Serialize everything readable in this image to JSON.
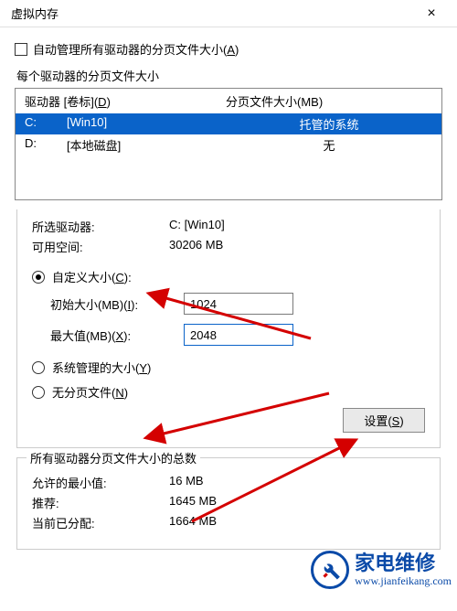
{
  "window": {
    "title": "虚拟内存",
    "close": "×"
  },
  "auto_manage": {
    "label_pre": "自动管理所有驱动器的分页文件大小(",
    "hotkey": "A",
    "label_post": ")"
  },
  "drive_section_label": "每个驱动器的分页文件大小",
  "drive_header": {
    "drive_pre": "驱动器 [卷标](",
    "drive_hotkey": "D",
    "drive_post": ")",
    "size": "分页文件大小(MB)"
  },
  "drives": [
    {
      "letter": "C:",
      "label": "[Win10]",
      "size": "托管的系统",
      "selected": true
    },
    {
      "letter": "D:",
      "label": "[本地磁盘]",
      "size": "无",
      "selected": false
    }
  ],
  "selected_info": {
    "drive_label": "所选驱动器:",
    "drive_value": "C:  [Win10]",
    "free_label": "可用空间:",
    "free_value": "30206 MB"
  },
  "custom": {
    "label_pre": "自定义大小(",
    "hotkey": "C",
    "label_post": "):",
    "initial_label_pre": "初始大小(MB)(",
    "initial_hotkey": "I",
    "initial_label_post": "):",
    "initial_value": "1024",
    "max_label_pre": "最大值(MB)(",
    "max_hotkey": "X",
    "max_label_post": "):",
    "max_value": "2048"
  },
  "system_managed": {
    "label_pre": "系统管理的大小(",
    "hotkey": "Y",
    "label_post": ")"
  },
  "no_paging": {
    "label_pre": "无分页文件(",
    "hotkey": "N",
    "label_post": ")"
  },
  "set_button": {
    "label_pre": "设置(",
    "hotkey": "S",
    "label_post": ")"
  },
  "totals": {
    "title": "所有驱动器分页文件大小的总数",
    "min_label": "允许的最小值:",
    "min_value": "16 MB",
    "rec_label": "推荐:",
    "rec_value": "1645 MB",
    "cur_label": "当前已分配:",
    "cur_value": "1664 MB"
  },
  "watermark": {
    "brand": "家电维修",
    "url": "www.jianfeikang.com"
  }
}
